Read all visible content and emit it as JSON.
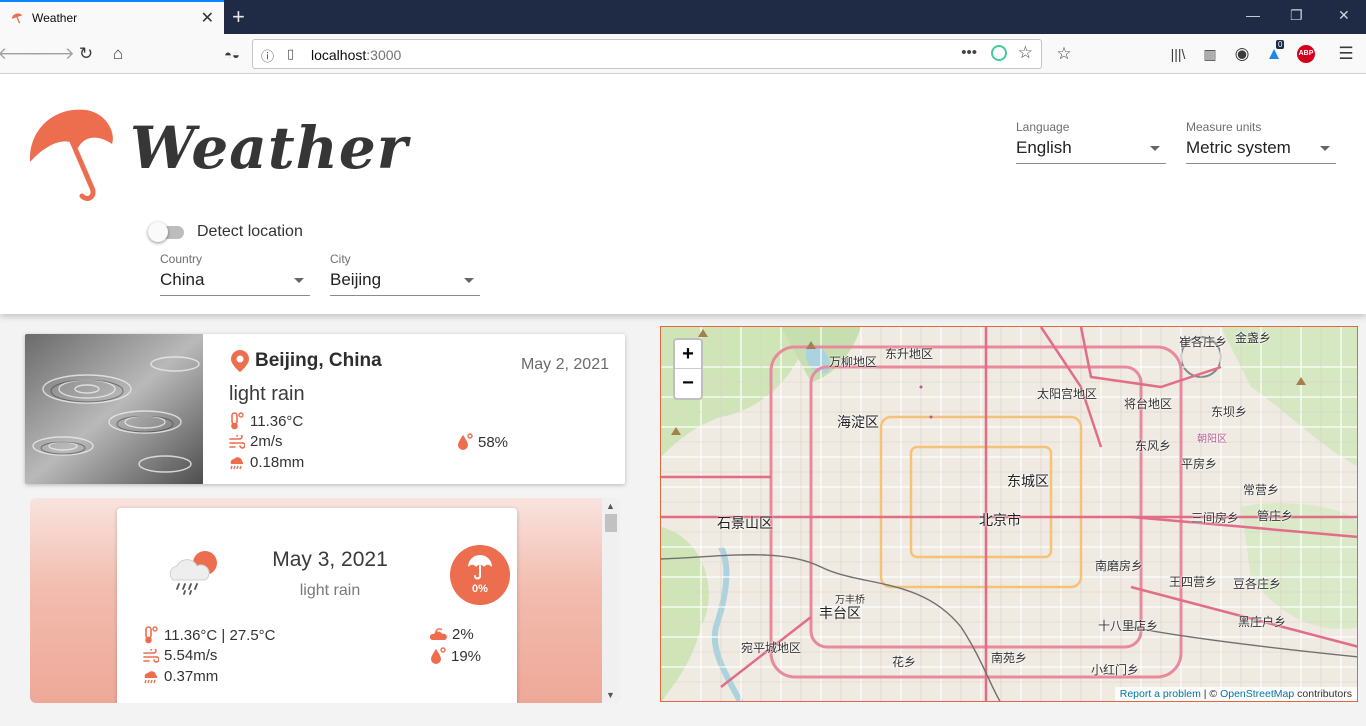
{
  "browser": {
    "tab_title": "Weather",
    "url_host": "localhost",
    "url_port": ":3000",
    "notification_count": "0",
    "abp_label": "ABP"
  },
  "app": {
    "title": "Weather",
    "colors": {
      "accent": "#ec6e4f",
      "accent_soft": "#f2bcae"
    }
  },
  "settings": {
    "language": {
      "label": "Language",
      "value": "English"
    },
    "units": {
      "label": "Measure units",
      "value": "Metric system"
    },
    "detect_location": {
      "label": "Detect location",
      "enabled": false
    },
    "country": {
      "label": "Country",
      "value": "China"
    },
    "city": {
      "label": "City",
      "value": "Beijing"
    }
  },
  "current": {
    "location": "Beijing, China",
    "date": "May 2, 2021",
    "description": "light rain",
    "temperature": "11.36°C",
    "wind": "2m/s",
    "precipitation": "0.18mm",
    "humidity": "58%"
  },
  "forecast": [
    {
      "date": "May 3, 2021",
      "description": "light rain",
      "precip_probability": "0%",
      "temperature": "11.36°C | 27.5°C",
      "wind": "5.54m/s",
      "precipitation": "0.37mm",
      "clouds": "2%",
      "humidity": "19%"
    }
  ],
  "map": {
    "zoom_in": "+",
    "zoom_out": "−",
    "attribution_report": "Report a problem",
    "attribution_sep": " | © ",
    "attribution_osm": "OpenStreetMap",
    "attribution_tail": " contributors",
    "labels": {
      "wanliu": "万柳地区",
      "dongsheng": "东升地区",
      "taiyanggong": "太阳宫地区",
      "jiangtai": "将台地区",
      "haidian": "海淀区",
      "dongcheng": "东城区",
      "shijingshan": "石景山区",
      "beijing": "北京市",
      "fengtai": "丰台区",
      "wanfengqiao": "万丰桥",
      "wanping": "宛平城地区",
      "huaxiang": "花乡",
      "nanyuan": "南苑乡",
      "pangezhuang": "崔各庄乡",
      "jinzhan": "金盏乡",
      "dongba": "东坝乡",
      "pingfang": "平房乡",
      "dongfeng": "东风乡",
      "changying": "常营乡",
      "sanjianfang": "三间房乡",
      "guanzhuang": "管庄乡",
      "nanmofang": "南磨房乡",
      "wangsiying": "王四营乡",
      "dougezhuang": "豆各庄乡",
      "shibalidian": "十八里店乡",
      "heizhuanghu": "黑庄户乡",
      "xiaohongmen": "小红门乡",
      "chaoyang": "朝阳区"
    }
  }
}
